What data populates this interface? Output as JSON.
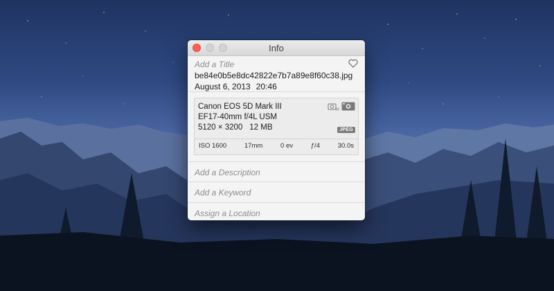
{
  "window": {
    "title": "Info"
  },
  "photo": {
    "title_placeholder": "Add a Title",
    "filename": "be84e0b5e8dc42822e7b7a89e8f60c38.jpg",
    "date": "August 6, 2013",
    "time": "20:46"
  },
  "exif": {
    "camera": "Canon EOS 5D Mark III",
    "lens": "EF17-40mm f/4L USM",
    "dimensions": "5120 × 3200",
    "file_size": "12 MB",
    "format_badge": "JPEG",
    "iso": "ISO 1600",
    "focal_length": "17mm",
    "exposure_bias": "0 ev",
    "aperture": "ƒ/4",
    "shutter": "30.0s"
  },
  "fields": {
    "description_placeholder": "Add a Description",
    "keyword_placeholder": "Add a Keyword",
    "location_placeholder": "Assign a Location"
  },
  "icons": [
    "close-button",
    "minimize-button",
    "zoom-button",
    "heart-icon",
    "white-balance-icon",
    "camera-icon"
  ]
}
